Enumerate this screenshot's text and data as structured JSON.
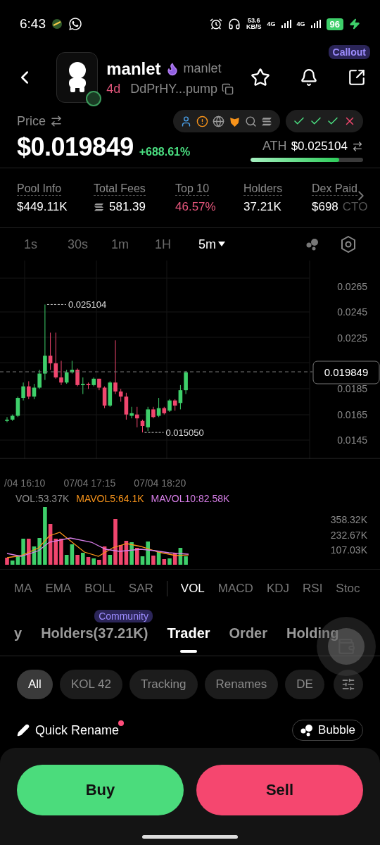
{
  "status_bar": {
    "time": "6:43",
    "net_speed": "53.6",
    "net_unit": "KB/S",
    "network_1": "4G",
    "network_2": "4G",
    "battery": "96"
  },
  "token": {
    "name": "manlet",
    "ticker": "manlet",
    "age": "4d",
    "address": "DdPrHY...pump",
    "badge": "Callout"
  },
  "price": {
    "label": "Price",
    "value": "$0.019849",
    "change": "+688.61%"
  },
  "audit_checks": [
    {
      "passed": true
    },
    {
      "passed": true
    },
    {
      "passed": true
    },
    {
      "passed": false
    }
  ],
  "ath": {
    "label": "ATH",
    "value": "$0.025104",
    "level": 0.79
  },
  "stats": [
    {
      "label": "Pool Info",
      "value": "$449.11K",
      "kind": "plain"
    },
    {
      "label": "Total Fees",
      "value": "581.39",
      "kind": "sol"
    },
    {
      "label": "Top 10",
      "value": "46.57%",
      "kind": "negative"
    },
    {
      "label": "Holders",
      "value": "37.21K",
      "kind": "plain"
    },
    {
      "label": "Dex Paid",
      "value": "$698",
      "kind": "plain",
      "suffix": "CTO"
    }
  ],
  "timeframes": [
    {
      "label": "1s",
      "selected": false
    },
    {
      "label": "30s",
      "selected": false
    },
    {
      "label": "1m",
      "selected": false
    },
    {
      "label": "1H",
      "selected": false
    },
    {
      "label": "5m",
      "selected": true
    }
  ],
  "chart": {
    "y_ticks": [
      "0.0265",
      "0.0245",
      "0.0225",
      "0.0185",
      "0.0165",
      "0.0145"
    ],
    "high_label": "0.025104",
    "low_label": "0.015050",
    "current_price": "0.019849"
  },
  "volume": {
    "time_labels": [
      "/04 16:10",
      "07/04 17:15",
      "07/04 18:20"
    ],
    "legend": [
      {
        "label": "VOL:53.37K",
        "color": "#8a8a8a"
      },
      {
        "label": "MAVOL5:64.1K",
        "color": "#f7931a"
      },
      {
        "label": "MAVOL10:82.58K",
        "color": "#d77ee8"
      }
    ],
    "y_ticks": [
      "358.32K",
      "232.67K",
      "107.03K"
    ]
  },
  "main_indicators": [
    {
      "label": "MA",
      "selected": false
    },
    {
      "label": "EMA",
      "selected": false
    },
    {
      "label": "BOLL",
      "selected": false
    },
    {
      "label": "SAR",
      "selected": false
    }
  ],
  "sub_indicators": [
    {
      "label": "VOL",
      "selected": true
    },
    {
      "label": "MACD",
      "selected": false
    },
    {
      "label": "KDJ",
      "selected": false
    },
    {
      "label": "RSI",
      "selected": false
    },
    {
      "label": "Stoc",
      "selected": false
    }
  ],
  "tabs": [
    {
      "label": "y",
      "selected": false
    },
    {
      "label": "Holders",
      "count": "(37.21K)",
      "badge": "Community",
      "selected": false
    },
    {
      "label": "Trader",
      "selected": true
    },
    {
      "label": "Order",
      "selected": false
    },
    {
      "label": "Holding",
      "selected": false
    }
  ],
  "filters": [
    {
      "label": "All",
      "selected": true
    },
    {
      "label": "KOL 42",
      "selected": false
    },
    {
      "label": "Tracking",
      "selected": false
    },
    {
      "label": "Renames",
      "selected": false
    },
    {
      "label": "DE",
      "selected": false
    }
  ],
  "quick_rename": {
    "label": "Quick Rename",
    "unread": true
  },
  "bubble_button": "Bubble",
  "actions": [
    {
      "label": "Buy",
      "kind": "buy"
    },
    {
      "label": "Sell",
      "kind": "sell"
    }
  ]
}
